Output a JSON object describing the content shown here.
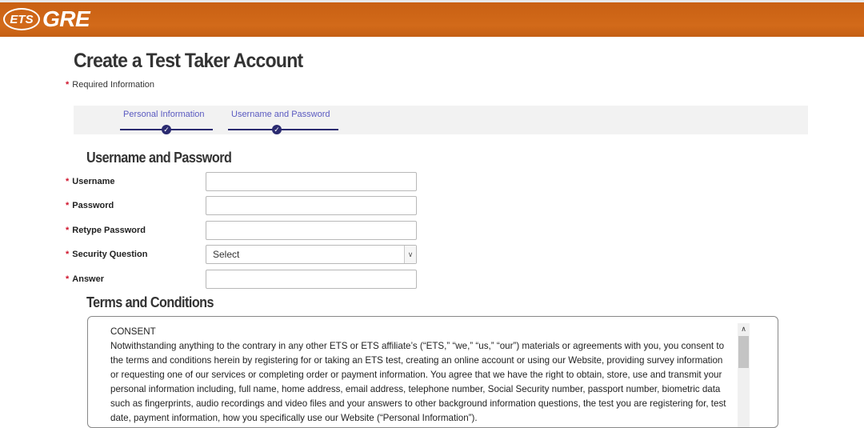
{
  "header": {
    "logo_ets": "ETS",
    "logo_gre": "GRE",
    "brand_color": "#d0651a"
  },
  "page": {
    "title": "Create a Test Taker Account",
    "required_note": "Required Information",
    "required_marker": "*"
  },
  "steps": [
    {
      "label": "Personal Information",
      "completed": true,
      "icon": "check-icon"
    },
    {
      "label": "Username and Password",
      "completed": true,
      "icon": "check-icon"
    }
  ],
  "username_section": {
    "title": "Username and Password",
    "fields": [
      {
        "label": "Username",
        "value": "",
        "type": "text"
      },
      {
        "label": "Password",
        "value": "",
        "type": "password"
      },
      {
        "label": "Retype Password",
        "value": "",
        "type": "password"
      },
      {
        "label": "Security Question",
        "value": "Select",
        "type": "select"
      },
      {
        "label": "Answer",
        "value": "",
        "type": "text"
      }
    ]
  },
  "terms": {
    "title": "Terms and Conditions",
    "heading": "CONSENT",
    "body": "Notwithstanding anything to the contrary in any other ETS or ETS affiliate’s (“ETS,” “we,” “us,” “our”) materials or agreements with you, you consent to the terms and conditions herein by registering for or taking an ETS test, creating an online account or using our Website, providing survey information or requesting one of our services or completing order or payment information.  You agree that we have the right to obtain, store, use and transmit your personal information including, full name, home address, email address, telephone number, Social Security number, passport number, biometric data such as fingerprints, audio recordings and video files and your answers to other background information questions, the test you are registering for, test date, payment information, how you specifically use our Website (“Personal Information”)."
  },
  "icons": {
    "step_check": "check-icon",
    "select_caret": "chevron-down-icon",
    "scroll_up": "chevron-up-icon"
  }
}
